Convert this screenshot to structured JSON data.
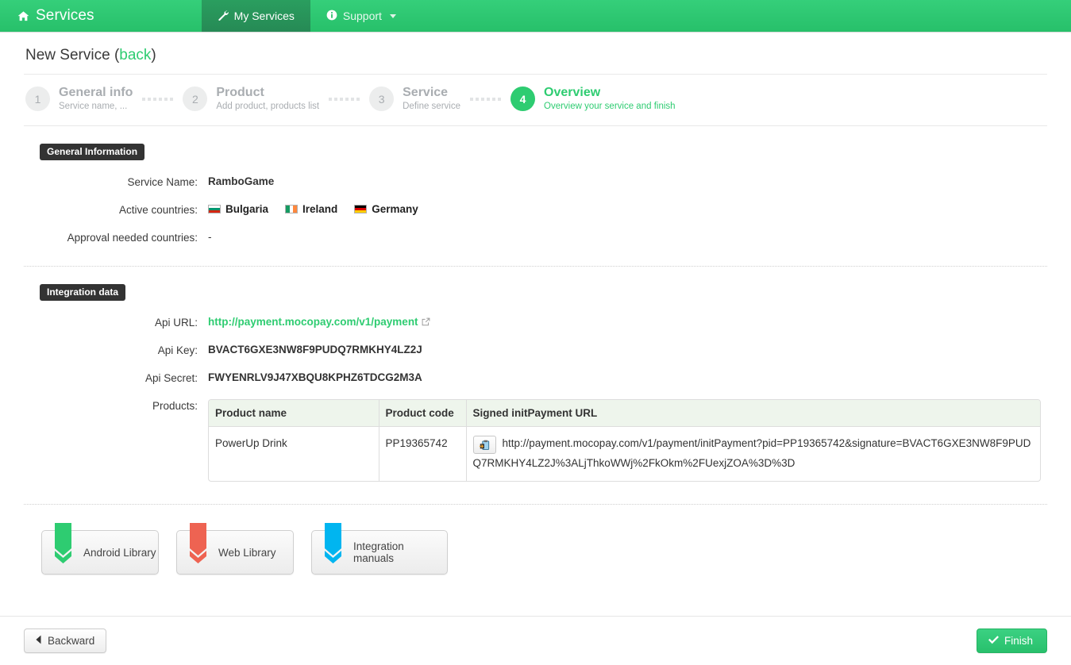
{
  "navbar": {
    "brand": "Services",
    "brand_icon": "home-icon",
    "items": [
      {
        "label": "My Services",
        "icon": "wrench-icon",
        "active": true,
        "caret": false
      },
      {
        "label": "Support",
        "icon": "info-circle-icon",
        "active": false,
        "caret": true
      }
    ]
  },
  "page": {
    "title": "New Service",
    "back_label": "back",
    "open_paren": "(",
    "close_paren": ")"
  },
  "wizard": {
    "steps": [
      {
        "num": "1",
        "title": "General info",
        "sub": "Service name, ...",
        "state": "inactive"
      },
      {
        "num": "2",
        "title": "Product",
        "sub": "Add product, products list",
        "state": "inactive"
      },
      {
        "num": "3",
        "title": "Service",
        "sub": "Define service",
        "state": "inactive"
      },
      {
        "num": "4",
        "title": "Overview",
        "sub": "Overview your service and finish",
        "state": "active"
      }
    ]
  },
  "general_information": {
    "section_label": "General Information",
    "service_name_label": "Service Name:",
    "service_name_value": "RamboGame",
    "active_countries_label": "Active countries:",
    "active_countries": [
      {
        "name": "Bulgaria",
        "flag": "bulgaria-flag",
        "colors": [
          "#ffffff",
          "#00966e",
          "#d62612"
        ],
        "orientation": "horizontal"
      },
      {
        "name": "Ireland",
        "flag": "ireland-flag",
        "colors": [
          "#169b62",
          "#ffffff",
          "#ff883e"
        ],
        "orientation": "vertical"
      },
      {
        "name": "Germany",
        "flag": "germany-flag",
        "colors": [
          "#000000",
          "#dd0000",
          "#ffce00"
        ],
        "orientation": "horizontal"
      }
    ],
    "approval_countries_label": "Approval needed countries:",
    "approval_countries_value": "-"
  },
  "integration_data": {
    "section_label": "Integration data",
    "api_url_label": "Api URL:",
    "api_url_value": "http://payment.mocopay.com/v1/payment",
    "api_url_icon": "external-link-icon",
    "api_key_label": "Api Key:",
    "api_key_value": "BVACT6GXE3NW8F9PUDQ7RMKHY4LZ2J",
    "api_secret_label": "Api Secret:",
    "api_secret_value": "FWYENRLV9J47XBQU8KPHZ6TDCG2M3A",
    "products_label": "Products:",
    "table": {
      "headers": [
        "Product name",
        "Product code",
        "Signed initPayment URL"
      ],
      "rows": [
        {
          "product_name": "PowerUp Drink",
          "product_code": "PP19365742",
          "copy_icon": "clipboard-paste-icon",
          "signed_url": "http://payment.mocopay.com/v1/payment/initPayment?pid=PP19365742&signature=BVACT6GXE3NW8F9PUDQ7RMKHY4LZ2J%3ALjThkoWWj%2FkOkm%2FUexjZOA%3D%3D"
        }
      ]
    }
  },
  "downloads": [
    {
      "label": "Android Library",
      "icon": "download-ribbon-icon",
      "color": "#2ecc71"
    },
    {
      "label": "Web Library",
      "icon": "download-ribbon-icon",
      "color": "#ee6352"
    },
    {
      "label": "Integration manuals",
      "icon": "download-ribbon-icon",
      "color": "#00b5f0"
    }
  ],
  "footer": {
    "backward_label": "Backward",
    "backward_icon": "chevron-left-icon",
    "finish_label": "Finish",
    "finish_icon": "check-icon"
  },
  "colors": {
    "brand_green": "#2ecc71",
    "nav_active": "#279a5c",
    "section_label_bg": "#333333",
    "table_header_bg": "#eef5ec"
  }
}
